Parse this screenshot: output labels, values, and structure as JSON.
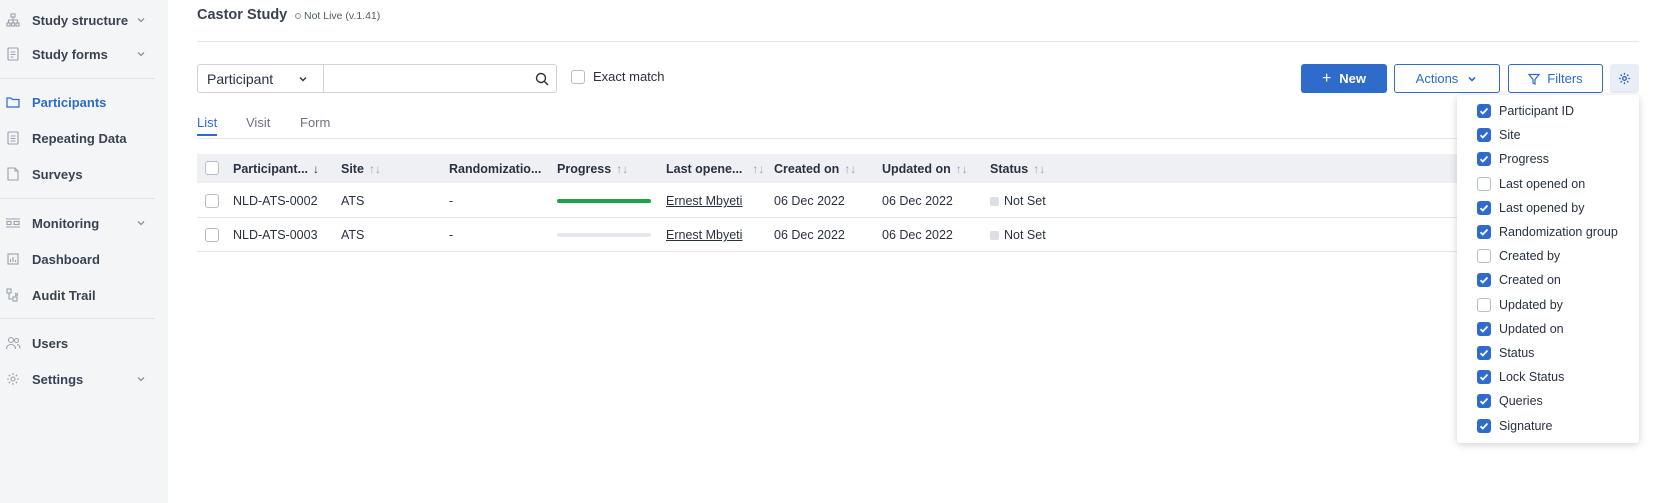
{
  "sidebar": {
    "items": [
      {
        "label": "Study structure",
        "icon": "hierarchy-icon",
        "chevron": true,
        "active": false
      },
      {
        "label": "Study forms",
        "icon": "form-icon",
        "chevron": true,
        "active": false
      },
      {
        "label": "Participants",
        "icon": "folder-icon",
        "chevron": false,
        "active": true
      },
      {
        "label": "Repeating Data",
        "icon": "document-icon",
        "chevron": false,
        "active": false
      },
      {
        "label": "Surveys",
        "icon": "survey-icon",
        "chevron": false,
        "active": false
      },
      {
        "label": "Monitoring",
        "icon": "monitoring-icon",
        "chevron": true,
        "active": false
      },
      {
        "label": "Dashboard",
        "icon": "dashboard-icon",
        "chevron": false,
        "active": false
      },
      {
        "label": "Audit Trail",
        "icon": "audit-trail-icon",
        "chevron": false,
        "active": false
      },
      {
        "label": "Users",
        "icon": "users-icon",
        "chevron": false,
        "active": false
      },
      {
        "label": "Settings",
        "icon": "settings-icon",
        "chevron": true,
        "active": false
      }
    ]
  },
  "header": {
    "study_title": "Castor Study",
    "study_status": "Not Live (v.1.41)"
  },
  "search": {
    "selected_option": "Participant",
    "query": "",
    "placeholder": "",
    "exact_match_label": "Exact match",
    "exact_match_checked": false
  },
  "toolbar": {
    "new_label": "New",
    "actions_label": "Actions",
    "filters_label": "Filters"
  },
  "tabs": [
    {
      "label": "List",
      "active": true
    },
    {
      "label": "Visit",
      "active": false
    },
    {
      "label": "Form",
      "active": false
    }
  ],
  "table": {
    "columns": [
      "Participant...",
      "Site",
      "Randomizatio...",
      "Progress",
      "Last opene...",
      "Created on",
      "Updated on",
      "Status"
    ],
    "rows": [
      {
        "participant": "NLD-ATS-0002",
        "site": "ATS",
        "randomization": "-",
        "progress": 1.0,
        "last_opened_by": "Ernest Mbyeti",
        "created_on": "06 Dec 2022",
        "updated_on": "06 Dec 2022",
        "status": "Not Set"
      },
      {
        "participant": "NLD-ATS-0003",
        "site": "ATS",
        "randomization": "-",
        "progress": 0.0,
        "last_opened_by": "Ernest Mbyeti",
        "created_on": "06 Dec 2022",
        "updated_on": "06 Dec 2022",
        "status": "Not Set"
      }
    ]
  },
  "column_panel": {
    "items": [
      {
        "label": "Participant ID",
        "checked": true
      },
      {
        "label": "Site",
        "checked": true
      },
      {
        "label": "Progress",
        "checked": true
      },
      {
        "label": "Last opened on",
        "checked": false
      },
      {
        "label": "Last opened by",
        "checked": true
      },
      {
        "label": "Randomization group",
        "checked": true
      },
      {
        "label": "Created by",
        "checked": false
      },
      {
        "label": "Created on",
        "checked": true
      },
      {
        "label": "Updated by",
        "checked": false
      },
      {
        "label": "Updated on",
        "checked": true
      },
      {
        "label": "Status",
        "checked": true
      },
      {
        "label": "Lock Status",
        "checked": true
      },
      {
        "label": "Queries",
        "checked": true
      },
      {
        "label": "Signature",
        "checked": true
      }
    ]
  },
  "colors": {
    "accent": "#2e6bcb",
    "progress_fill": "#1fa34a",
    "sidebar_bg": "#f4f5f7"
  }
}
